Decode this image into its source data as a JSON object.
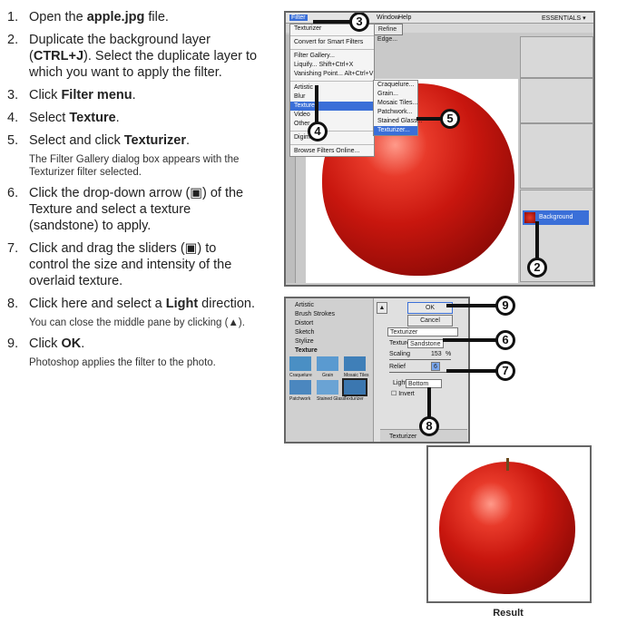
{
  "steps": [
    {
      "num": "1.",
      "pre": "Open the ",
      "bold": "apple.jpg",
      "post": " file.",
      "note": ""
    },
    {
      "num": "2.",
      "pre": "Duplicate the background layer (",
      "bold": "CTRL+J",
      "post": "). Select the duplicate layer to which you want to apply the filter.",
      "note": ""
    },
    {
      "num": "3.",
      "pre": "Click ",
      "bold": "Filter menu",
      "post": ".",
      "note": ""
    },
    {
      "num": "4.",
      "pre": "Select ",
      "bold": "Texture",
      "post": ".",
      "note": ""
    },
    {
      "num": "5.",
      "pre": "Select and click ",
      "bold": "Texturizer",
      "post": ".",
      "note": "The Filter Gallery dialog box appears with the Texturizer filter selected."
    },
    {
      "num": "6.",
      "pre": "Click the drop-down arrow (▣) of the Texture and select a texture (sandstone) to apply.",
      "bold": "",
      "post": "",
      "note": ""
    },
    {
      "num": "7.",
      "pre": "Click and drag the sliders (▣) to control the size and intensity of the overlaid texture.",
      "bold": "",
      "post": "",
      "note": ""
    },
    {
      "num": "8.",
      "pre": "Click here and select a ",
      "bold": "Light",
      "post": " direction.",
      "note": "You can close the middle pane by clicking (▲)."
    },
    {
      "num": "9.",
      "pre": "Click ",
      "bold": "OK",
      "post": ".",
      "note": "Photoshop applies the filter to the photo."
    }
  ],
  "ps": {
    "menubar": {
      "filter": "Filter",
      "window": "Window",
      "help": "Help",
      "essentials": "ESSENTIALS ▾"
    },
    "filter_menu": [
      "Texturizer",
      "Convert for Smart Filters",
      "Filter Gallery...",
      "Liquify...      Shift+Ctrl+X",
      "Vanishing Point...  Alt+Ctrl+V",
      "Artistic",
      "Blur",
      "Texture",
      "Video",
      "Other",
      "Digimarc",
      "Browse Filters Online..."
    ],
    "texture_submenu": [
      "Craquelure...",
      "Grain...",
      "Mosaic Tiles...",
      "Patchwork...",
      "Stained Glass...",
      "Texturizer..."
    ],
    "refine_edge": "Refine Edge...",
    "layer_name": "Background"
  },
  "gallery": {
    "folders": [
      "Artistic",
      "Brush Strokes",
      "Distort",
      "Sketch",
      "Stylize",
      "Texture"
    ],
    "thumbs": [
      "Craquelure",
      "Grain",
      "Mosaic Tiles",
      "Patchwork",
      "Stained Glass",
      "Texturizer"
    ],
    "ok": "OK",
    "cancel": "Cancel",
    "filter_select": "Texturizer",
    "texture_label": "Texture:",
    "texture_value": "Sandstone",
    "scaling_label": "Scaling",
    "scaling_value": "153",
    "scaling_unit": "%",
    "relief_label": "Relief",
    "relief_value": "6",
    "light_label": "Light:",
    "light_value": "Bottom",
    "invert_label": "Invert",
    "layer_item": "Texturizer"
  },
  "callouts": [
    "3",
    "4",
    "5",
    "2",
    "9",
    "6",
    "7",
    "8"
  ],
  "result_caption": "Result"
}
